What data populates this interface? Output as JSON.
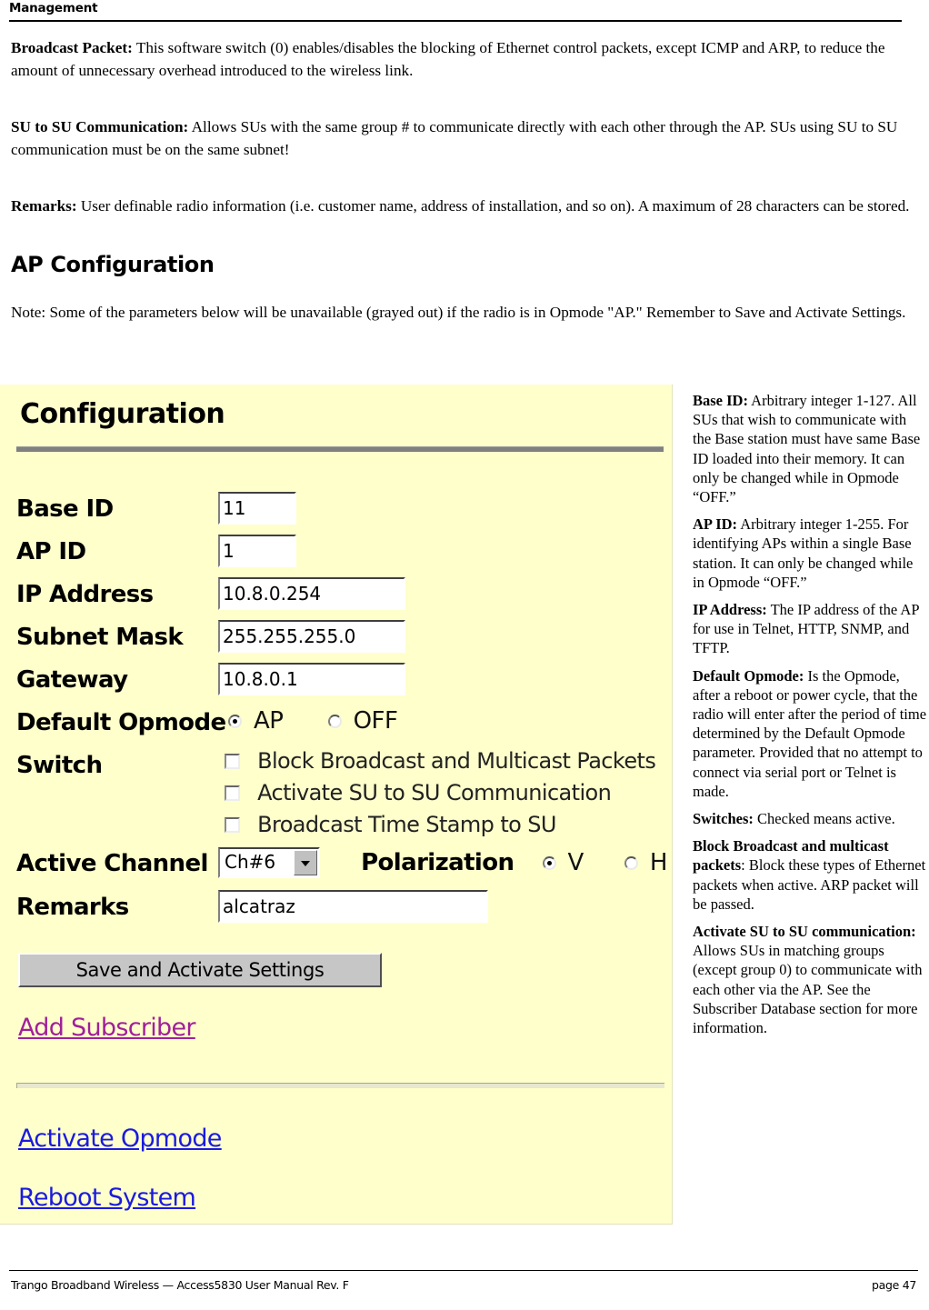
{
  "header": {
    "running_head": "Management"
  },
  "prose": {
    "broadcast_packet_label": "Broadcast Packet:",
    "broadcast_packet_text": "  This software switch (0) enables/disables the blocking of Ethernet control packets, except ICMP and ARP, to reduce the amount of unnecessary overhead introduced to the wireless link.",
    "su_to_su_label": "SU to SU Communication:",
    "su_to_su_text": "  Allows SUs with the same group # to communicate directly with each other through the AP.  SUs using SU to SU communication must be on the same subnet!",
    "remarks_label": "Remarks:",
    "remarks_text": "  User definable radio information (i.e. customer name, address of installation, and so on).  A maximum of 28 characters can be stored.",
    "section_title": "AP Configuration",
    "note_text": "Note:  Some of the parameters below will be unavailable (grayed out) if the radio is in Opmode \"AP.\"  Remember to Save and Activate Settings."
  },
  "config_screenshot": {
    "title": "Configuration",
    "fields": [
      {
        "label": "Base ID",
        "value": "11",
        "width": "small"
      },
      {
        "label": "AP ID",
        "value": "1",
        "width": "small"
      },
      {
        "label": "IP Address",
        "value": "10.8.0.254",
        "width": "med"
      },
      {
        "label": "Subnet Mask",
        "value": "255.255.255.0",
        "width": "med"
      },
      {
        "label": "Gateway",
        "value": "10.8.0.1",
        "width": "med"
      }
    ],
    "default_opmode": {
      "label": "Default Opmode",
      "options": [
        {
          "label": "AP",
          "selected": true
        },
        {
          "label": "OFF",
          "selected": false
        }
      ]
    },
    "switch": {
      "label": "Switch",
      "checkboxes": [
        {
          "label": "Block Broadcast and Multicast Packets",
          "checked": false
        },
        {
          "label": "Activate SU to SU Communication",
          "checked": false
        },
        {
          "label": "Broadcast Time Stamp to SU",
          "checked": false
        }
      ]
    },
    "active_channel": {
      "label": "Active Channel",
      "selected": "Ch#6"
    },
    "polarization": {
      "label": "Polarization",
      "options": [
        {
          "label": "V",
          "selected": true
        },
        {
          "label": "H",
          "selected": false
        }
      ]
    },
    "remarks": {
      "label": "Remarks",
      "value": "alcatraz"
    },
    "save_button": "Save and Activate Settings",
    "links": [
      {
        "label": "Add Subscriber",
        "state": "visited"
      },
      {
        "label": "Activate Opmode",
        "state": "normal"
      },
      {
        "label": "Reboot System",
        "state": "normal"
      }
    ]
  },
  "annotations": [
    {
      "term": " Base ID:",
      "body": " Arbitrary integer 1-127.  All SUs that wish to communicate with the Base station must have same Base ID loaded into their memory.  It can only be changed while in Opmode “OFF.”"
    },
    {
      "term": "AP ID:",
      "body": " Arbitrary integer 1-255. For identifying APs within a single Base station. It can only be changed while in Opmode “OFF.”"
    },
    {
      "term": "IP Address:",
      "body": " The IP address of the AP for use in Telnet, HTTP, SNMP, and TFTP."
    },
    {
      "term": "Default Opmode:",
      "body": " Is the Opmode, after a reboot or power cycle, that the radio will enter after the period of time determined by the Default Opmode parameter.  Provided that no attempt to connect via serial port or Telnet is made."
    },
    {
      "term": "Switches:",
      "body": " Checked means active."
    },
    {
      "term": "Block Broadcast and multicast packets",
      "body": ":  Block these types of Ethernet packets when active.  ARP packet will be passed."
    },
    {
      "term": "Activate SU to SU communication:",
      "body": "  Allows SUs in matching groups (except group 0) to communicate with each other via the AP. See the Subscriber Database section for more information."
    }
  ],
  "footer": {
    "left": "Trango Broadband Wireless — Access5830 User Manual  Rev. F",
    "right": "page 47"
  }
}
